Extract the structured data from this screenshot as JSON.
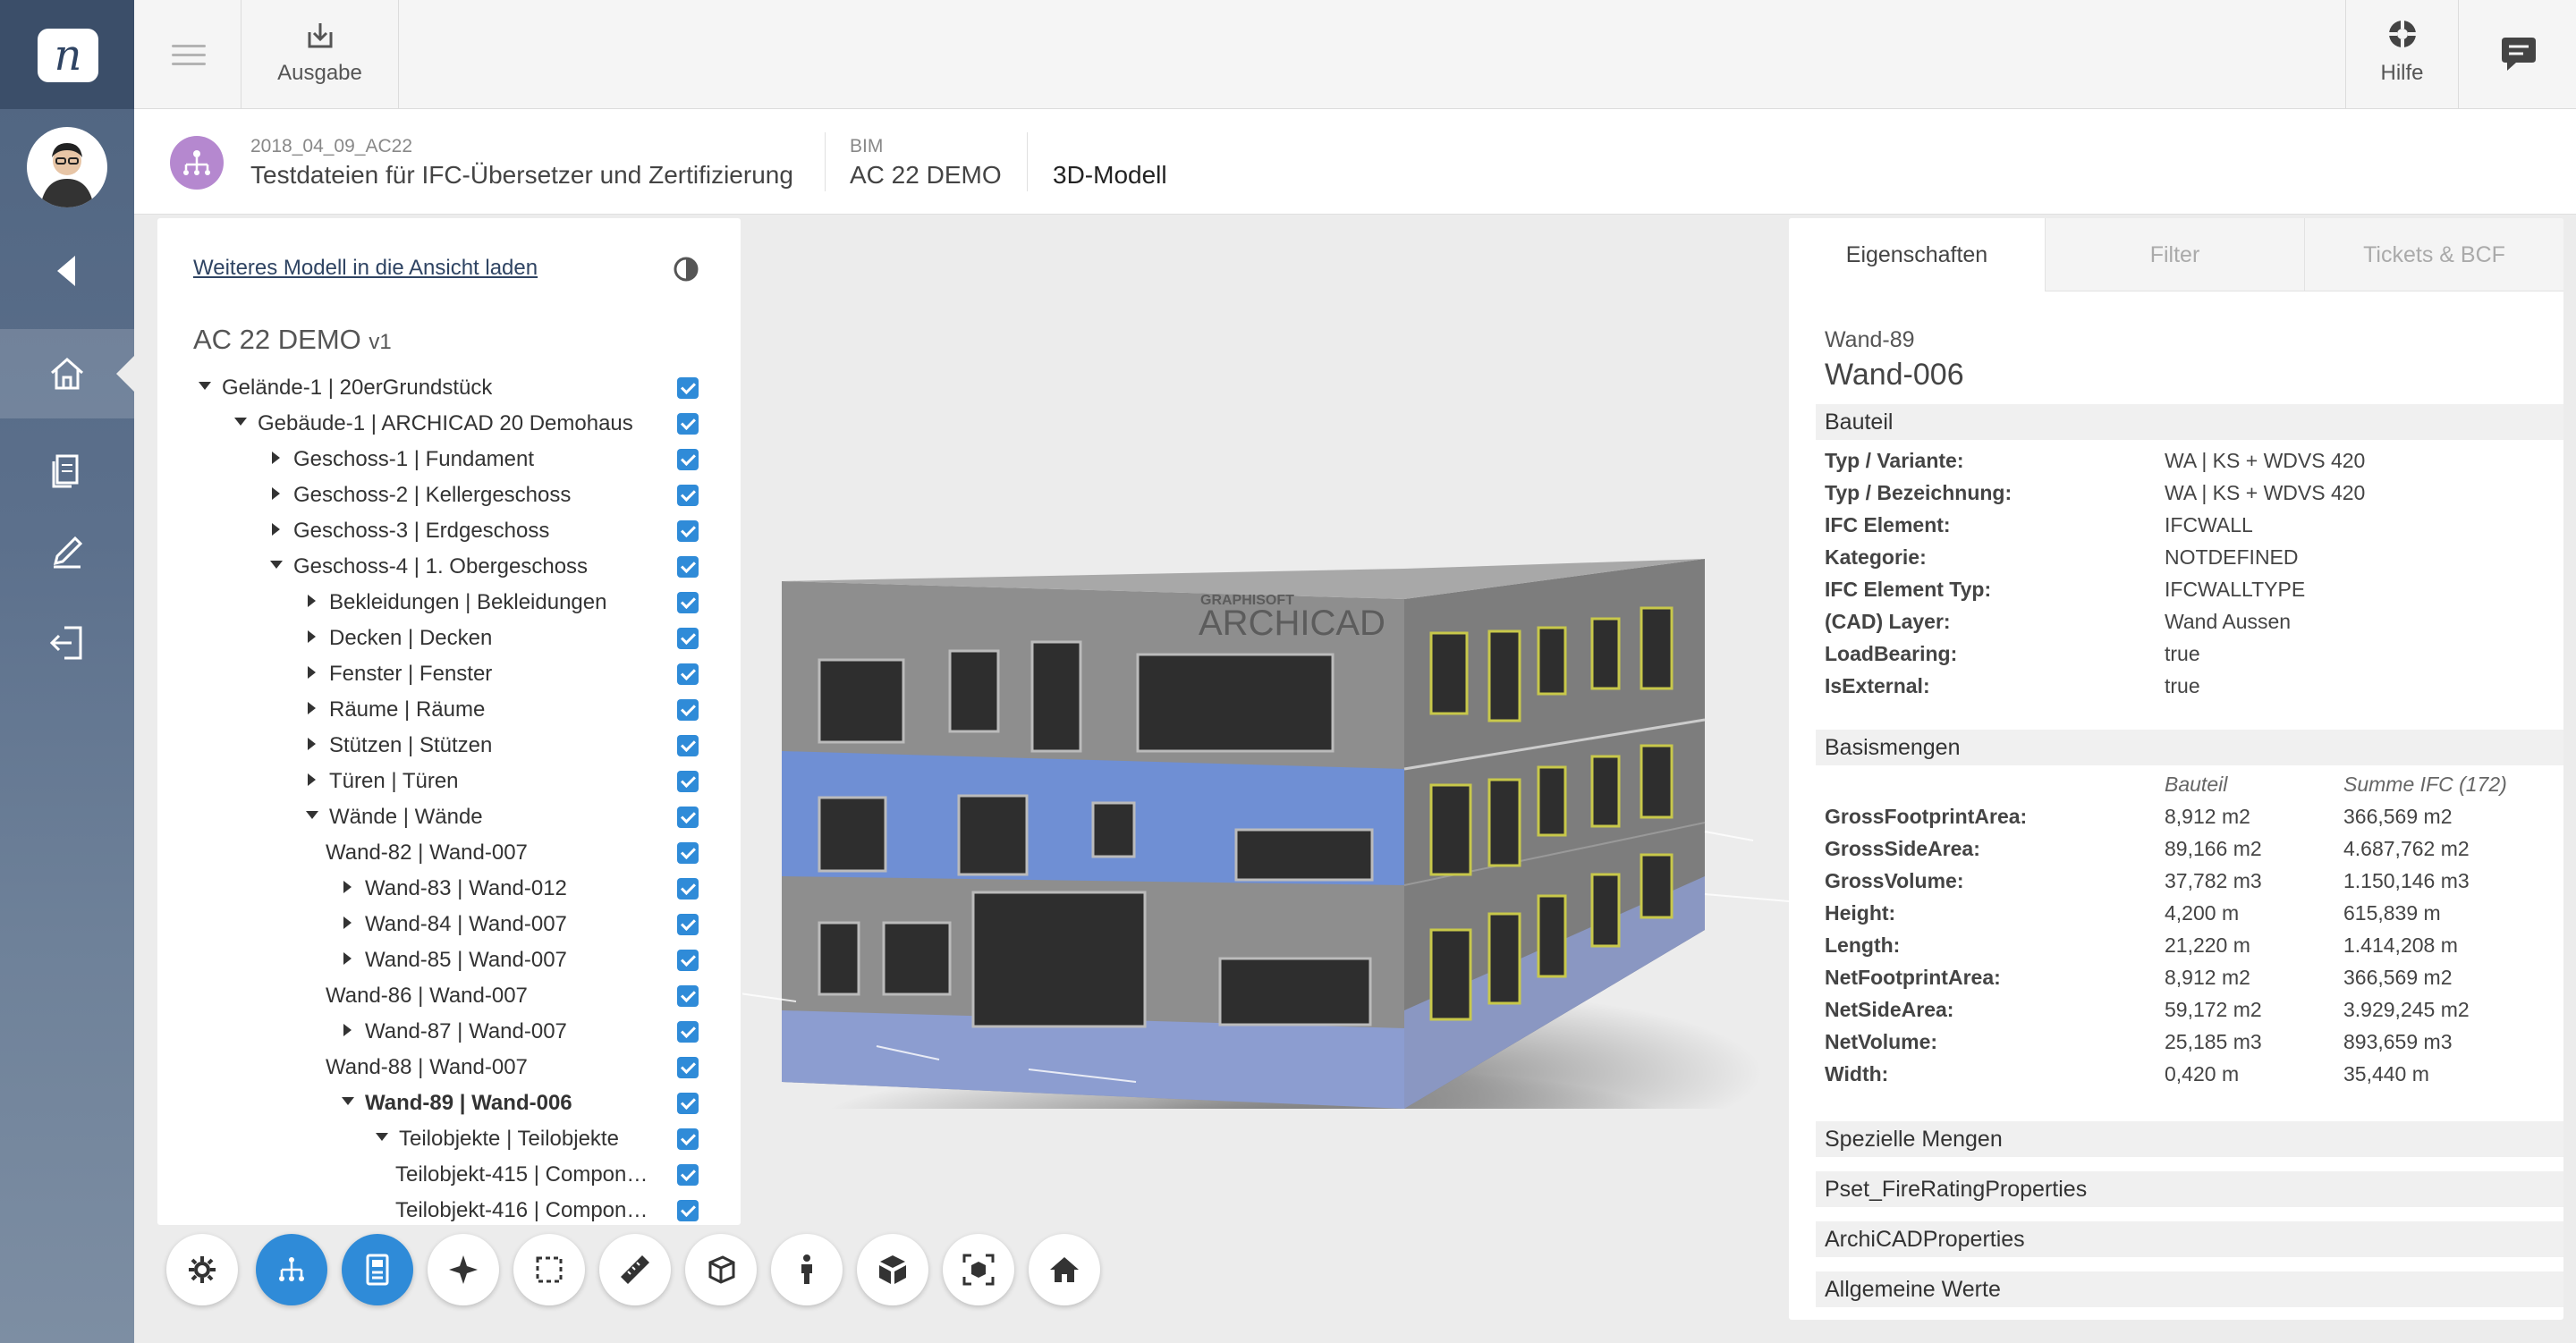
{
  "app": {
    "logo_letter": "n"
  },
  "topbar": {
    "export_label": "Ausgabe",
    "help_label": "Hilfe"
  },
  "breadcrumb": {
    "project_date": "2018_04_09_AC22",
    "project_name": "Testdateien für IFC-Übersetzer und Zertifizierung",
    "category": "BIM",
    "model_name": "AC 22 DEMO",
    "view_name": "3D-Modell"
  },
  "tree": {
    "load_link": "Weiteres Modell in die Ansicht laden",
    "title": "AC 22 DEMO",
    "version": "v1",
    "rows": [
      {
        "label": "Gelände-1 | 20erGrundstück",
        "level": 0,
        "toggle": "open"
      },
      {
        "label": "Gebäude-1 | ARCHICAD 20 Demohaus",
        "level": 1,
        "toggle": "open"
      },
      {
        "label": "Geschoss-1 | Fundament",
        "level": 2,
        "toggle": "closed"
      },
      {
        "label": "Geschoss-2 | Kellergeschoss",
        "level": 2,
        "toggle": "closed"
      },
      {
        "label": "Geschoss-3 | Erdgeschoss",
        "level": 2,
        "toggle": "closed"
      },
      {
        "label": "Geschoss-4 | 1. Obergeschoss",
        "level": 2,
        "toggle": "open"
      },
      {
        "label": "Bekleidungen | Bekleidungen",
        "level": 3,
        "toggle": "closed"
      },
      {
        "label": "Decken | Decken",
        "level": 3,
        "toggle": "closed"
      },
      {
        "label": "Fenster | Fenster",
        "level": 3,
        "toggle": "closed"
      },
      {
        "label": "Räume | Räume",
        "level": 3,
        "toggle": "closed"
      },
      {
        "label": "Stützen | Stützen",
        "level": 3,
        "toggle": "closed"
      },
      {
        "label": "Türen | Türen",
        "level": 3,
        "toggle": "closed"
      },
      {
        "label": "Wände | Wände",
        "level": 3,
        "toggle": "open"
      },
      {
        "label": "Wand-82 | Wand-007",
        "level": 4,
        "toggle": "none"
      },
      {
        "label": "Wand-83 | Wand-012",
        "level": 4,
        "toggle": "closed"
      },
      {
        "label": "Wand-84 | Wand-007",
        "level": 4,
        "toggle": "closed"
      },
      {
        "label": "Wand-85 | Wand-007",
        "level": 4,
        "toggle": "closed"
      },
      {
        "label": "Wand-86 | Wand-007",
        "level": 4,
        "toggle": "none"
      },
      {
        "label": "Wand-87 | Wand-007",
        "level": 4,
        "toggle": "closed"
      },
      {
        "label": "Wand-88 | Wand-007",
        "level": 4,
        "toggle": "none"
      },
      {
        "label": "Wand-89 | Wand-006",
        "level": 4,
        "toggle": "open",
        "selected": true
      },
      {
        "label": "Teilobjekte | Teilobjekte",
        "level": 5,
        "toggle": "open"
      },
      {
        "label": "Teilobjekt-415 | Compon…",
        "level": 6,
        "toggle": "none"
      },
      {
        "label": "Teilobjekt-416 | Compon…",
        "level": 6,
        "toggle": "none"
      }
    ]
  },
  "viewport": {
    "sign_small": "GRAPHISOFT",
    "sign_big": "ARCHICAD"
  },
  "toolbar": {
    "buttons": [
      {
        "icon": "gear-icon",
        "active": false
      },
      {
        "icon": "model-tree-icon",
        "active": true
      },
      {
        "icon": "properties-icon",
        "active": true
      },
      {
        "icon": "navigate-icon",
        "active": false
      },
      {
        "icon": "selection-box-icon",
        "active": false
      },
      {
        "icon": "measure-ruler-icon",
        "active": false
      },
      {
        "icon": "section-box-icon",
        "active": false
      },
      {
        "icon": "walk-person-icon",
        "active": false
      },
      {
        "icon": "explode-icon",
        "active": false
      },
      {
        "icon": "focus-icon",
        "active": false
      },
      {
        "icon": "home-view-icon",
        "active": false
      }
    ]
  },
  "props": {
    "tabs": [
      "Eigenschaften",
      "Filter",
      "Tickets & BCF"
    ],
    "subtitle": "Wand-89",
    "heading": "Wand-006",
    "bauteil_title": "Bauteil",
    "bauteil": [
      {
        "k": "Typ / Variante:",
        "v": "WA | KS + WDVS 420"
      },
      {
        "k": "Typ / Bezeichnung:",
        "v": "WA | KS + WDVS 420"
      },
      {
        "k": "IFC Element:",
        "v": "IFCWALL"
      },
      {
        "k": "Kategorie:",
        "v": "NOTDEFINED"
      },
      {
        "k": "IFC Element Typ:",
        "v": "IFCWALLTYPE"
      },
      {
        "k": "(CAD) Layer:",
        "v": "Wand Aussen"
      },
      {
        "k": "LoadBearing:",
        "v": "true"
      },
      {
        "k": "IsExternal:",
        "v": "true"
      }
    ],
    "basis_title": "Basismengen",
    "basis_col1": "Bauteil",
    "basis_col2": "Summe IFC (172)",
    "basis": [
      {
        "k": "GrossFootprintArea:",
        "v": "8,912 m2",
        "s": "366,569 m2"
      },
      {
        "k": "GrossSideArea:",
        "v": "89,166 m2",
        "s": "4.687,762 m2"
      },
      {
        "k": "GrossVolume:",
        "v": "37,782 m3",
        "s": "1.150,146 m3"
      },
      {
        "k": "Height:",
        "v": "4,200 m",
        "s": "615,839 m"
      },
      {
        "k": "Length:",
        "v": "21,220 m",
        "s": "1.414,208 m"
      },
      {
        "k": "NetFootprintArea:",
        "v": "8,912 m2",
        "s": "366,569 m2"
      },
      {
        "k": "NetSideArea:",
        "v": "59,172 m2",
        "s": "3.929,245 m2"
      },
      {
        "k": "NetVolume:",
        "v": "25,185 m3",
        "s": "893,659 m3"
      },
      {
        "k": "Width:",
        "v": "0,420 m",
        "s": "35,440 m"
      }
    ],
    "more_sections": [
      "Spezielle Mengen",
      "Pset_FireRatingProperties",
      "ArchiCADProperties",
      "Allgemeine Werte"
    ]
  },
  "colors": {
    "accent": "#2f8bd8",
    "rail": "#4f6480",
    "badge": "#b588cf",
    "facade_blue": "#6f8fd4"
  }
}
